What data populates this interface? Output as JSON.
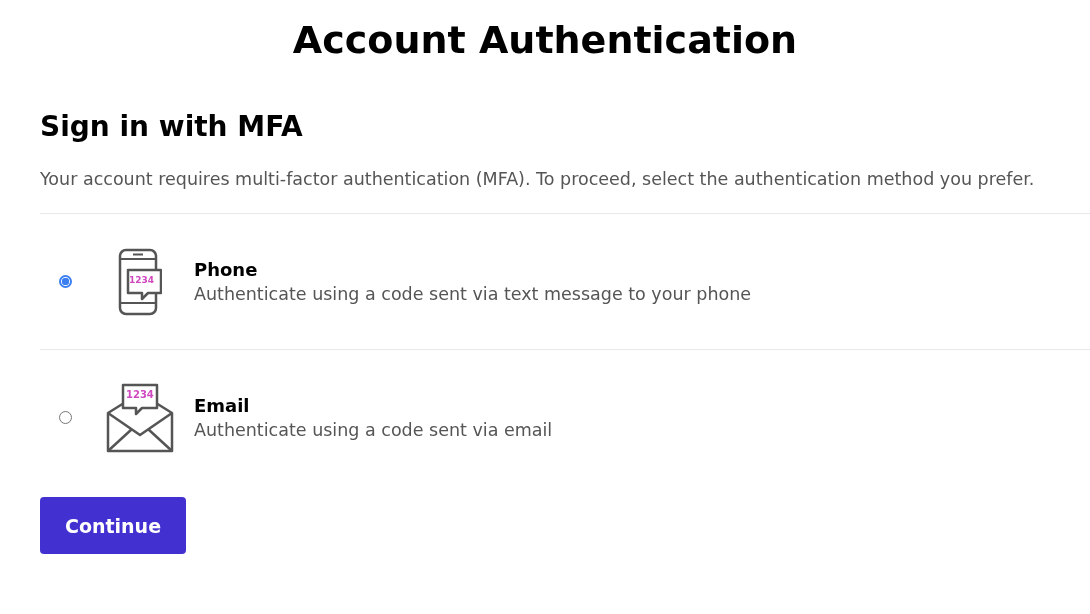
{
  "title": "Account Authentication",
  "heading": "Sign in with MFA",
  "description": "Your account requires multi-factor authentication (MFA). To proceed, select the authentication method you prefer.",
  "options": [
    {
      "kind": "phone",
      "label": "Phone",
      "detail": "Authenticate using a code sent via text message to your phone",
      "code": "1234",
      "selected": true
    },
    {
      "kind": "email",
      "label": "Email",
      "detail": "Authenticate using a code sent via email",
      "code": "1234",
      "selected": false
    }
  ],
  "button": "Continue"
}
